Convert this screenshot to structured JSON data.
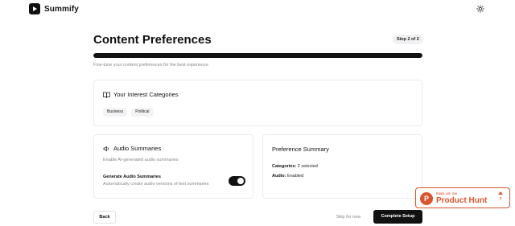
{
  "app": {
    "name": "Summify"
  },
  "header": {
    "theme_icon": "sun-icon"
  },
  "page": {
    "title": "Content Preferences",
    "step": "Step 2 of 2",
    "progress_fraction": 1.0,
    "subtitle": "Fine-tune your content preferences for the best experience"
  },
  "interests": {
    "heading": "Your Interest Categories",
    "icon": "book-open-icon",
    "tags": [
      "Business",
      "Political"
    ]
  },
  "audio": {
    "heading": "Audio Summaries",
    "icon": "speaker-icon",
    "description": "Enable AI-generated audio summaries",
    "generate_title": "Generate Audio Summaries",
    "generate_desc": "Automatically create audio versions of text summaries",
    "enabled": true
  },
  "summary": {
    "heading": "Preference Summary",
    "categories_label": "Categories:",
    "categories_value": "2 selected",
    "audio_label": "Audio:",
    "audio_value": "Enabled"
  },
  "actions": {
    "back": "Back",
    "skip": "Skip for now",
    "complete": "Complete Setup"
  },
  "product_hunt": {
    "small": "FIND US ON",
    "big": "Product Hunt",
    "count": "7",
    "accent": "#da552f"
  }
}
